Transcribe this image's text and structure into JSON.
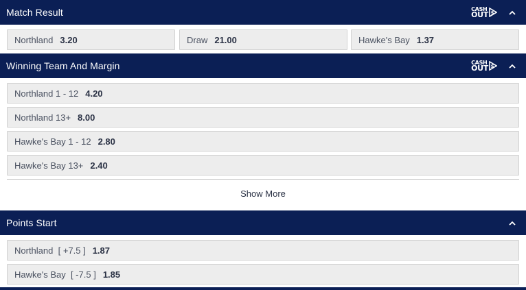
{
  "markets": [
    {
      "title": "Match Result",
      "cashout_top": "CASH",
      "cashout_bottom": "OUT",
      "selections": [
        {
          "label": "Northland",
          "odds": "3.20"
        },
        {
          "label": "Draw",
          "odds": "21.00"
        },
        {
          "label": "Hawke's Bay",
          "odds": "1.37"
        }
      ]
    },
    {
      "title": "Winning Team And Margin",
      "cashout_top": "CASH",
      "cashout_bottom": "OUT",
      "selections": [
        {
          "label": "Northland 1 - 12",
          "odds": "4.20"
        },
        {
          "label": "Northland 13+",
          "odds": "8.00"
        },
        {
          "label": "Hawke's Bay 1 - 12",
          "odds": "2.80"
        },
        {
          "label": "Hawke's Bay 13+",
          "odds": "2.40"
        }
      ],
      "show_more": "Show More"
    },
    {
      "title": "Points Start",
      "selections": [
        {
          "label": "Northland  [ +7.5 ]",
          "odds": "1.87"
        },
        {
          "label": "Hawke's Bay  [ -7.5 ]",
          "odds": "1.85"
        }
      ]
    }
  ],
  "icons": {
    "collapse": "chevron-up-icon",
    "cashout": "cashout-icon"
  },
  "colors": {
    "header_bg": "#0b1f55",
    "button_bg": "#ededed"
  }
}
